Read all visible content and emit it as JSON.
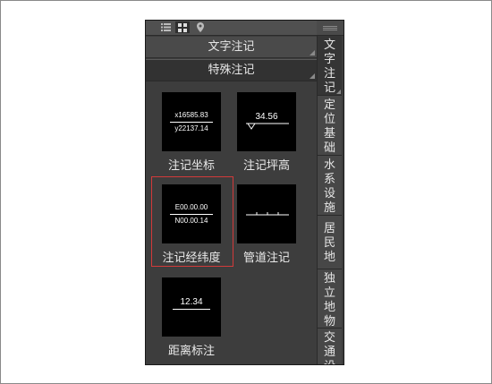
{
  "panel": {
    "category_text_notes": "文字注记",
    "category_special_notes": "特殊注记"
  },
  "items": [
    {
      "label": "注记坐标",
      "line1": "x16585.83",
      "line2": "y22137.14"
    },
    {
      "label": "注记坪高",
      "value": "34.56"
    },
    {
      "label": "注记经纬度",
      "line1": "E00.00.00",
      "line2": "N00.00.14"
    },
    {
      "label": "管道注记"
    },
    {
      "label": "距离标注",
      "value": "12.34"
    }
  ],
  "tabs": [
    {
      "chars": [
        "文",
        "字",
        "注",
        "记"
      ]
    },
    {
      "chars": [
        "定",
        "位",
        "基",
        "础"
      ]
    },
    {
      "chars": [
        "水",
        "系",
        "设",
        "施"
      ]
    },
    {
      "chars": [
        "居",
        "民",
        "地"
      ]
    },
    {
      "chars": [
        "独",
        "立",
        "地",
        "物"
      ]
    },
    {
      "chars": [
        "交",
        "通",
        "设"
      ]
    }
  ],
  "icons": {
    "topbar": [
      "list-view-icon",
      "grid-view-icon",
      "location-pin-icon"
    ]
  },
  "colors": {
    "panel_bg": "#3d3d3d",
    "selection_border": "#d23a3a",
    "thumbnail_bg": "#000000"
  }
}
